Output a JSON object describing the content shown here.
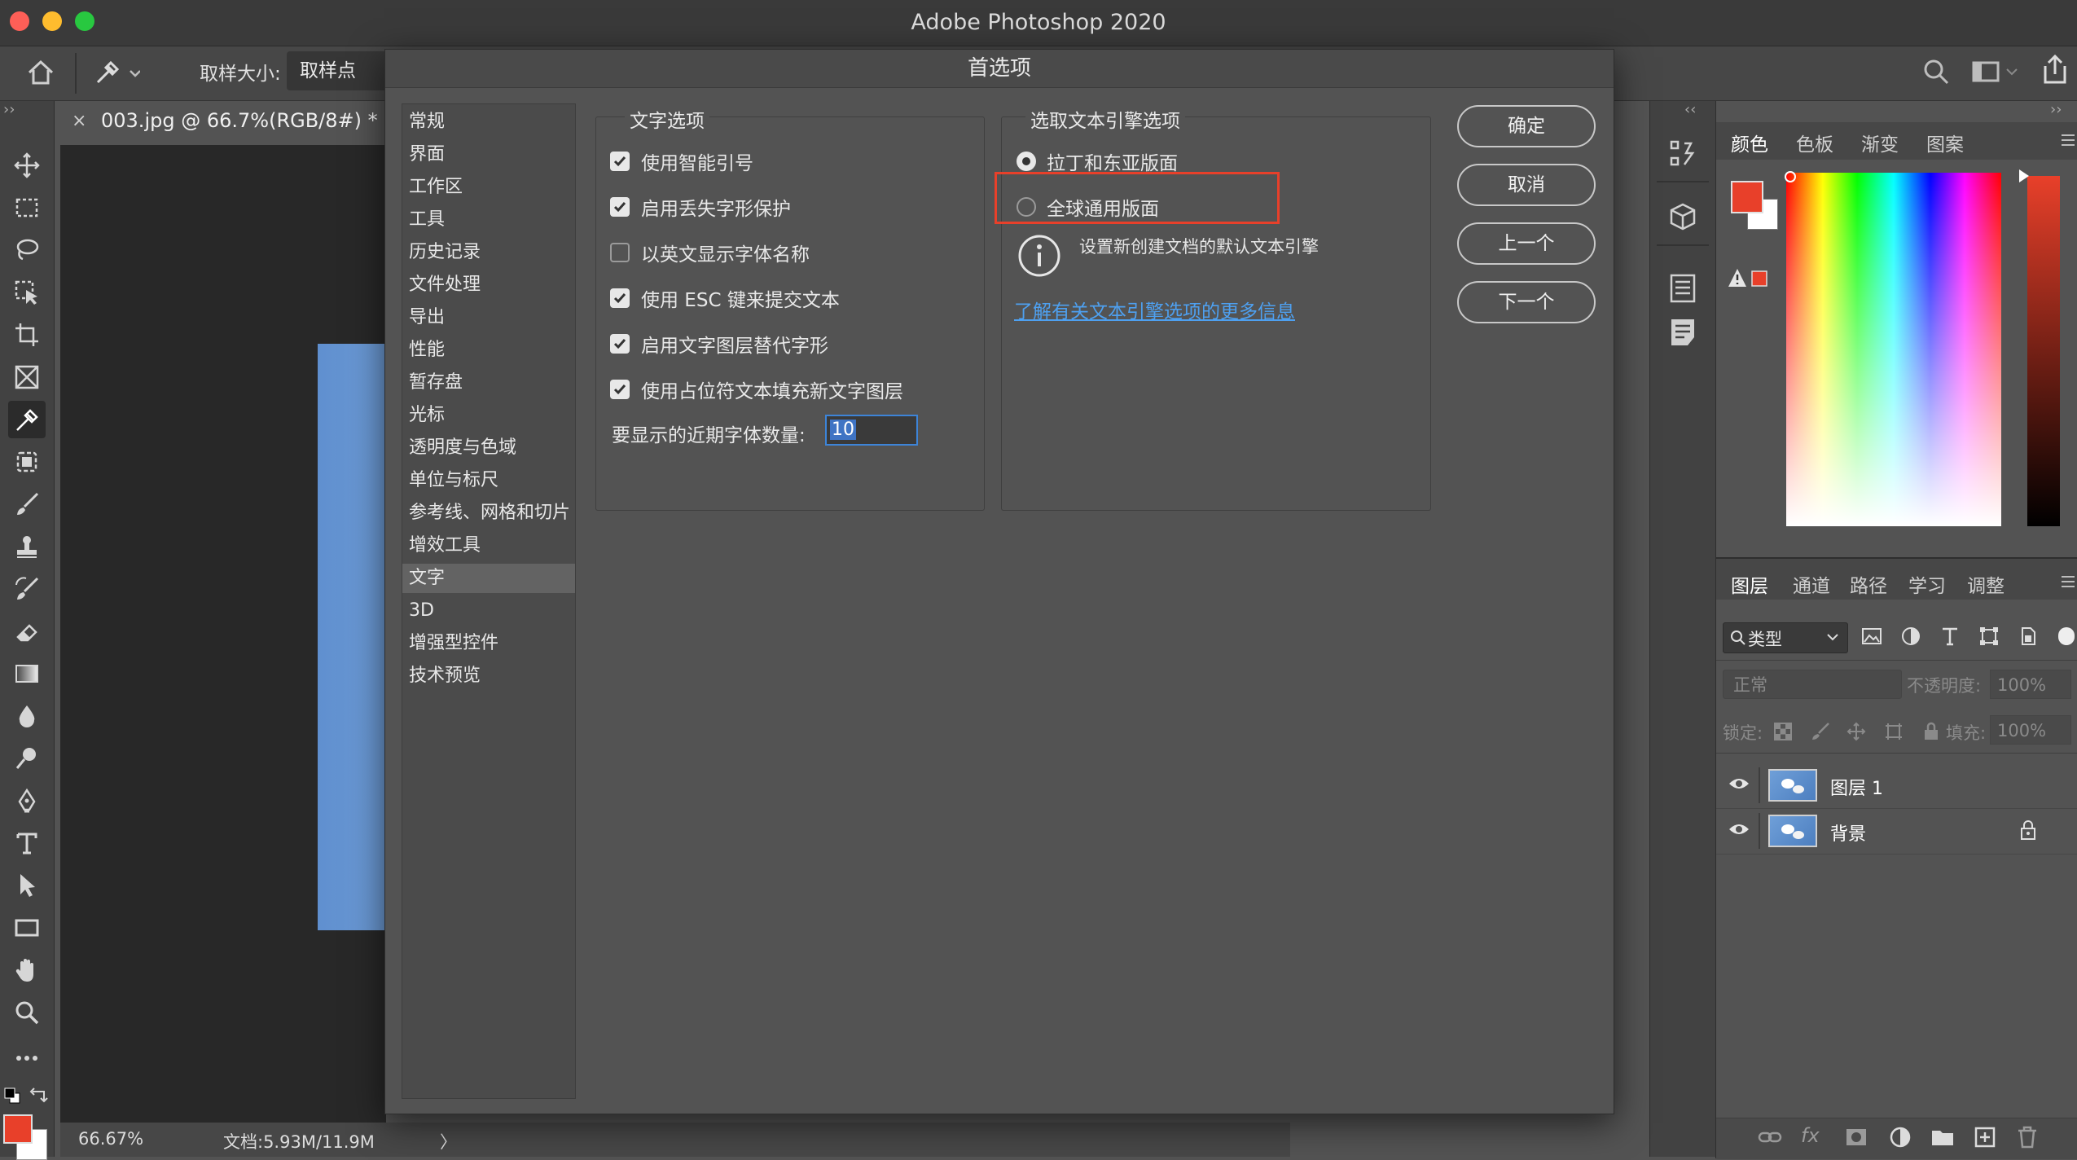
{
  "app": {
    "title": "Adobe Photoshop 2020"
  },
  "options_bar": {
    "sample_size_label": "取样大小:",
    "sample_size_value": "取样点"
  },
  "document": {
    "tab_title": "003.jpg @ 66.7%(RGB/8#) *",
    "close_glyph": "×",
    "zoom": "66.67%",
    "doc_info": "文档:5.93M/11.9M",
    "status_arrow": "〉"
  },
  "dialog": {
    "title": "首选项",
    "categories": [
      "常规",
      "界面",
      "工作区",
      "工具",
      "历史记录",
      "文件处理",
      "导出",
      "性能",
      "暂存盘",
      "光标",
      "透明度与色域",
      "单位与标尺",
      "参考线、网格和切片",
      "增效工具",
      "文字",
      "3D",
      "增强型控件",
      "技术预览"
    ],
    "selected_category": "文字",
    "text_options": {
      "title": "文字选项",
      "items": [
        {
          "label": "使用智能引号",
          "checked": true
        },
        {
          "label": "启用丢失字形保护",
          "checked": true
        },
        {
          "label": "以英文显示字体名称",
          "checked": false
        },
        {
          "label": "使用 ESC 键来提交文本",
          "checked": true
        },
        {
          "label": "启用文字图层替代字形",
          "checked": true
        },
        {
          "label": "使用占位符文本填充新文字图层",
          "checked": true
        }
      ],
      "recent_fonts_label": "要显示的近期字体数量:",
      "recent_fonts_value": "10"
    },
    "engine_options": {
      "title": "选取文本引擎选项",
      "radio_latin": "拉丁和东亚版面",
      "radio_world": "全球通用版面",
      "selected": "拉丁和东亚版面",
      "info_text": "设置新创建文档的默认文本引擎",
      "link_text": "了解有关文本引擎选项的更多信息"
    },
    "buttons": {
      "ok": "确定",
      "cancel": "取消",
      "prev": "上一个",
      "next": "下一个"
    }
  },
  "color_panel": {
    "tabs": [
      "颜色",
      "色板",
      "渐变",
      "图案"
    ],
    "active_tab": "颜色",
    "foreground_color": "#e8402a",
    "background_color": "#ffffff"
  },
  "layers_panel": {
    "tabs": [
      "图层",
      "通道",
      "路径",
      "学习",
      "调整"
    ],
    "active_tab": "图层",
    "filter_kind": "类型",
    "blend_mode": "正常",
    "opacity_label": "不透明度:",
    "opacity_value": "100%",
    "lock_label": "锁定:",
    "fill_label": "填充:",
    "fill_value": "100%",
    "layers": [
      {
        "name": "图层 1",
        "visible": true,
        "locked": false
      },
      {
        "name": "背景",
        "visible": true,
        "locked": true
      }
    ]
  },
  "colors": {
    "highlight_box": "#e8402a",
    "link": "#4ea0f0",
    "foreground": "#e8402a"
  }
}
